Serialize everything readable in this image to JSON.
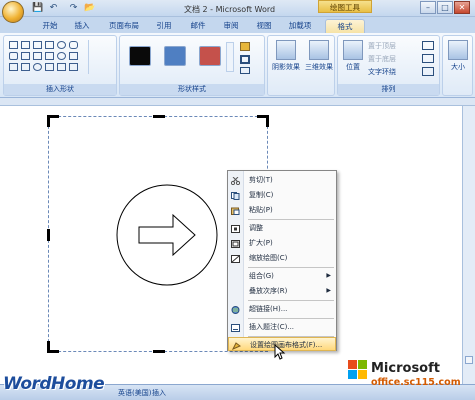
{
  "window": {
    "title": "文档 2 - Microsoft Word",
    "context_tools": "绘图工具",
    "min": "–",
    "max": "□",
    "close": "✕"
  },
  "quick_access": [
    "💾",
    "↶",
    "↷",
    "📂"
  ],
  "tabs": [
    "开始",
    "插入",
    "页面布局",
    "引用",
    "邮件",
    "审阅",
    "视图",
    "加载项",
    "格式"
  ],
  "active_tab": "格式",
  "ribbon": {
    "insert_shapes_label": "插入形状",
    "shape_styles_label": "形状样式",
    "arrange_label": "排列",
    "swatch_colors": [
      "#0a0a0a",
      "#4f7fc2",
      "#c5514b"
    ],
    "shadow_effects": "阴影效果",
    "three_d_effects": "三维效果",
    "position": "位置",
    "bring_to_front": "置于顶层",
    "send_to_back": "置于底层",
    "text_wrap": "文字环绕",
    "size": "大小"
  },
  "context_menu": {
    "items": [
      {
        "icon": "scissors-icon",
        "label": "剪切(T)",
        "disabled": false
      },
      {
        "icon": "copy-icon",
        "label": "复制(C)",
        "disabled": false
      },
      {
        "icon": "paste-icon",
        "label": "粘贴(P)",
        "disabled": false
      },
      {
        "icon": "adjust-icon",
        "label": "调整",
        "disabled": false
      },
      {
        "icon": "expand-icon",
        "label": "扩大(P)",
        "disabled": false
      },
      {
        "icon": "scale-drawing-icon",
        "label": "缩放绘图(C)",
        "disabled": false
      },
      {
        "icon": "",
        "label": "组合(G)",
        "submenu": true
      },
      {
        "icon": "",
        "label": "叠放次序(R)",
        "submenu": true
      },
      {
        "icon": "hyperlink-icon",
        "label": "超链接(H)...",
        "disabled": false
      },
      {
        "icon": "insert-caption-icon",
        "label": "插入题注(C)...",
        "disabled": false
      },
      {
        "icon": "format-canvas-icon",
        "label": "设置绘图画布格式(F)...",
        "highlighted": true
      }
    ]
  },
  "status": {
    "language": "英语(美国)",
    "mode": "插入"
  },
  "watermark": {
    "left": "WordHome",
    "brand": "Microsoft",
    "domain": "office.sc115.com"
  }
}
